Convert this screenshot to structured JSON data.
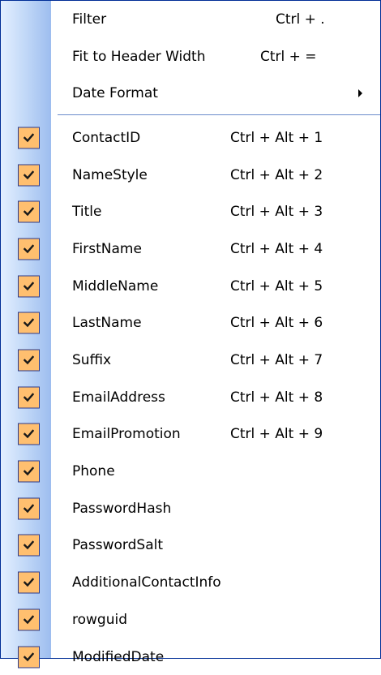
{
  "menu": {
    "top_items": [
      {
        "label": "Filter",
        "shortcut": "Ctrl + ."
      },
      {
        "label": "Fit to Header Width",
        "shortcut": "Ctrl + ="
      },
      {
        "label": "Date Format",
        "shortcut": "",
        "has_submenu": true
      }
    ],
    "column_items": [
      {
        "label": "ContactID",
        "shortcut": "Ctrl + Alt + 1",
        "checked": true
      },
      {
        "label": "NameStyle",
        "shortcut": "Ctrl + Alt + 2",
        "checked": true
      },
      {
        "label": "Title",
        "shortcut": "Ctrl + Alt + 3",
        "checked": true
      },
      {
        "label": "FirstName",
        "shortcut": "Ctrl + Alt + 4",
        "checked": true
      },
      {
        "label": "MiddleName",
        "shortcut": "Ctrl + Alt + 5",
        "checked": true
      },
      {
        "label": "LastName",
        "shortcut": "Ctrl + Alt + 6",
        "checked": true
      },
      {
        "label": "Suffix",
        "shortcut": "Ctrl + Alt + 7",
        "checked": true
      },
      {
        "label": "EmailAddress",
        "shortcut": "Ctrl + Alt + 8",
        "checked": true
      },
      {
        "label": "EmailPromotion",
        "shortcut": "Ctrl + Alt + 9",
        "checked": true
      },
      {
        "label": "Phone",
        "shortcut": "",
        "checked": true
      },
      {
        "label": "PasswordHash",
        "shortcut": "",
        "checked": true
      },
      {
        "label": "PasswordSalt",
        "shortcut": "",
        "checked": true
      },
      {
        "label": "AdditionalContactInfo",
        "shortcut": "",
        "checked": true
      },
      {
        "label": "rowguid",
        "shortcut": "",
        "checked": true
      },
      {
        "label": "ModifiedDate",
        "shortcut": "",
        "checked": true
      }
    ]
  },
  "colors": {
    "border": "#002d96",
    "gutter_light": "#e3efff",
    "gutter_dark": "#9dbdef",
    "checkbox_fill": "#ffbf6f",
    "checkbox_border": "#2b3a8a",
    "separator": "#6a8ccb"
  },
  "icons": {
    "check": "checkmark-icon",
    "submenu": "submenu-arrow-icon"
  }
}
